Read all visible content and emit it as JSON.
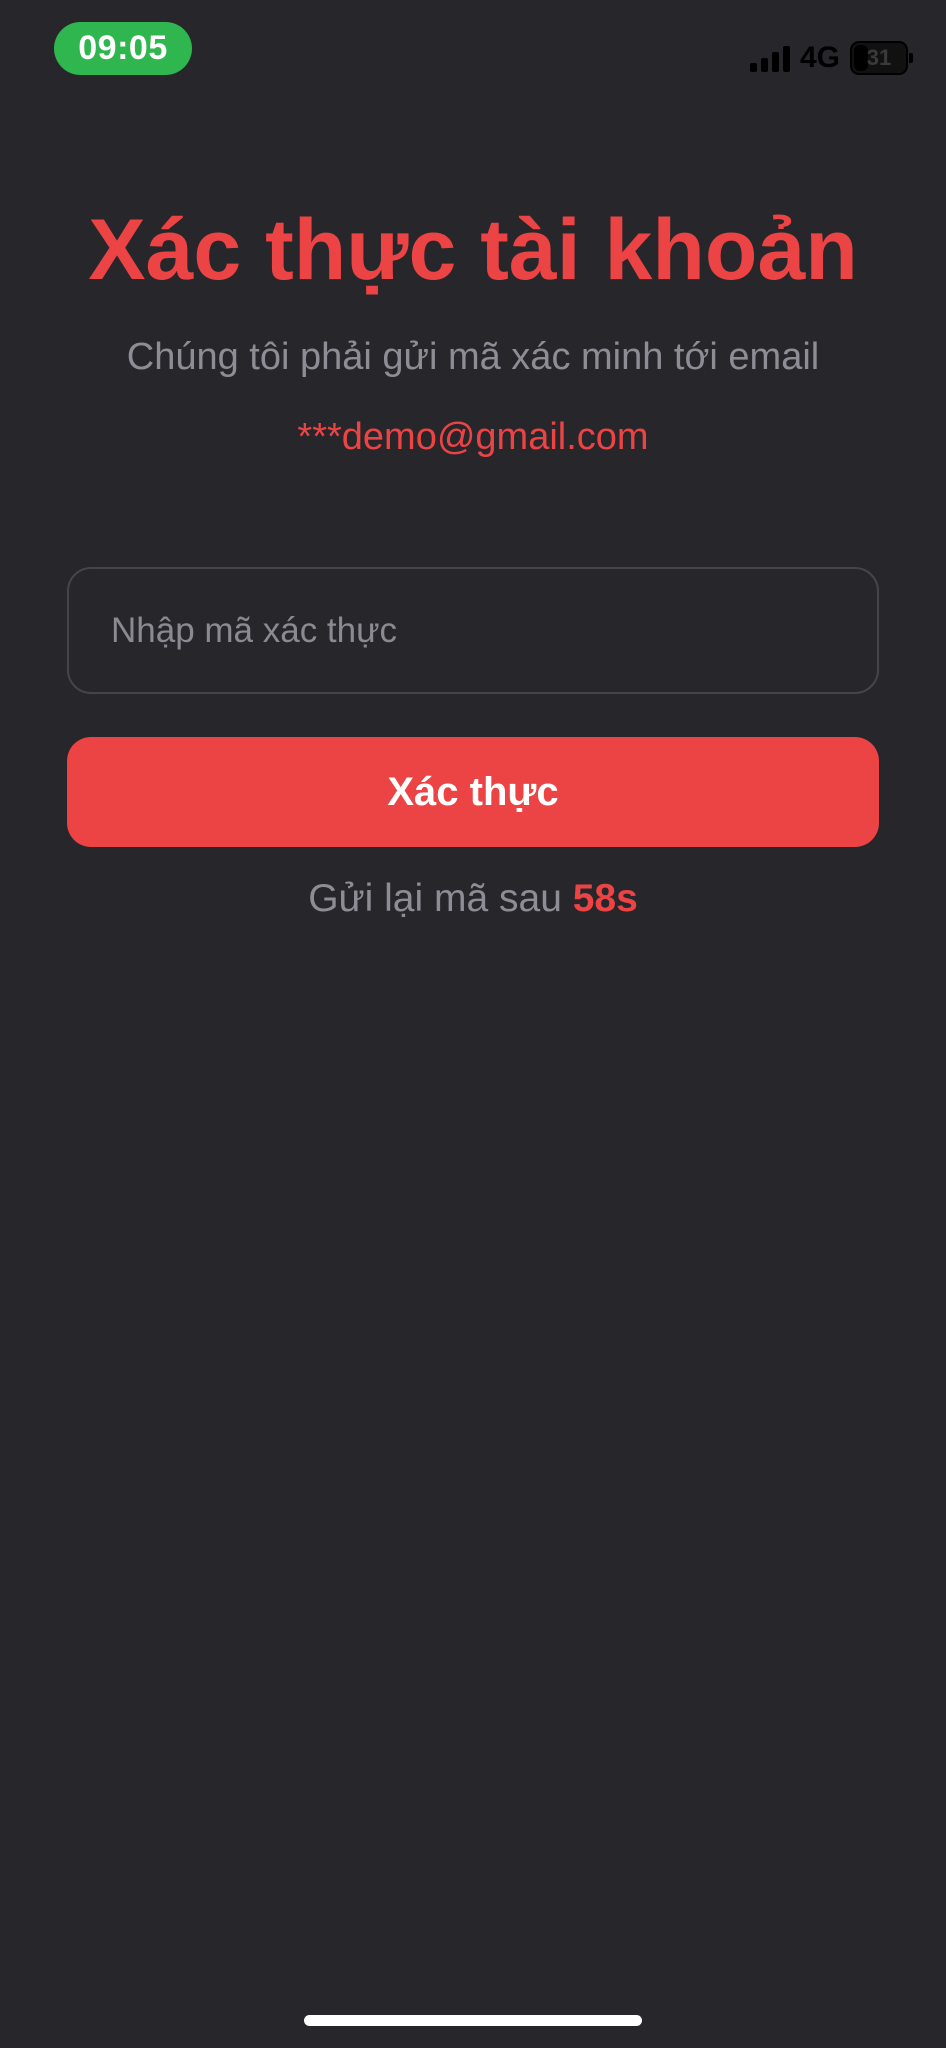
{
  "status_bar": {
    "time": "09:05",
    "network": "4G",
    "battery_level": "31",
    "time_pill_color": "#2fb64e"
  },
  "screen": {
    "title": "Xác thực tài khoản",
    "subtitle": "Chúng tôi phải gửi mã xác minh tới email",
    "email": "***demo@gmail.com",
    "code_input": {
      "placeholder": "Nhập mã xác thực",
      "value": ""
    },
    "verify_button_label": "Xác thực",
    "resend_text": "Gửi lại mã sau",
    "resend_countdown": "58s"
  },
  "colors": {
    "background": "#27262b",
    "accent": "#ec4444",
    "muted_text": "#8e8d96"
  }
}
